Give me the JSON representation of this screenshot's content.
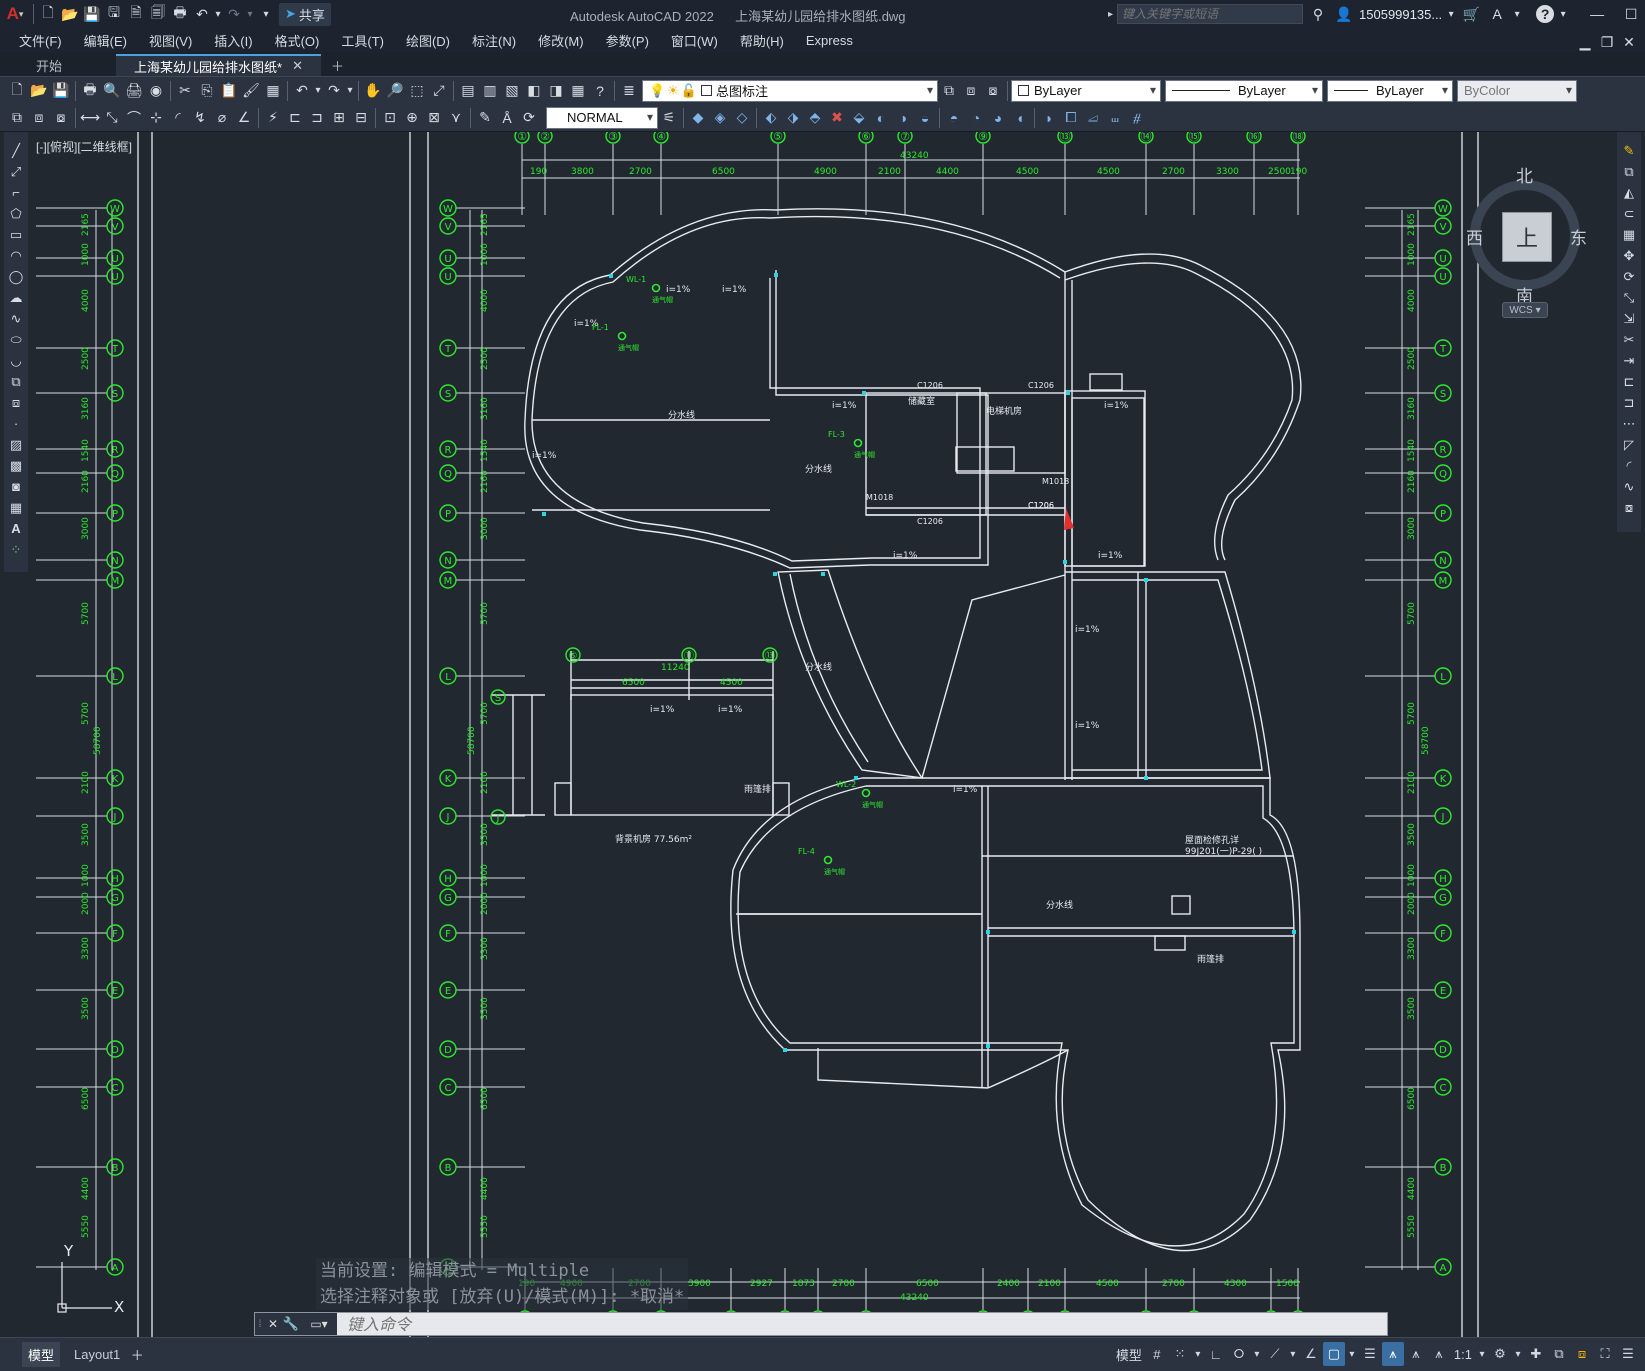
{
  "app": {
    "name": "Autodesk AutoCAD 2022",
    "file": "上海某幼儿园给排水图纸.dwg",
    "share_label": "共享",
    "search_placeholder": "键入关键字或短语",
    "user": "1505999135...",
    "accent_color": "#4aa3e0",
    "logo_color": "#d0312d"
  },
  "menubar": [
    "文件(F)",
    "编辑(E)",
    "视图(V)",
    "插入(I)",
    "格式(O)",
    "工具(T)",
    "绘图(D)",
    "标注(N)",
    "修改(M)",
    "参数(P)",
    "窗口(W)",
    "帮助(H)",
    "Express"
  ],
  "tabs": [
    {
      "label": "开始",
      "active": false
    },
    {
      "label": "上海某幼儿园给排水图纸*",
      "active": true
    }
  ],
  "toolbar": {
    "layer_name": "总图标注",
    "color": "ByLayer",
    "linetype": "ByLayer",
    "lineweight": "ByLayer",
    "plotstyle": "ByColor",
    "dimstyle": "NORMAL"
  },
  "viewport_label": "[-][俯视][二维线框]",
  "viewcube": {
    "north": "北",
    "south": "南",
    "east": "东",
    "west": "西",
    "top": "上",
    "wcs": "WCS"
  },
  "drawing": {
    "grid_cols_top": [
      "①",
      "②",
      "③",
      "④",
      "⑤",
      "⑥",
      "⑦",
      "⑧",
      "⑨",
      "⑩",
      "⑪",
      "⑫",
      "⑬",
      "⑭",
      "⑮",
      "⑯",
      "⑰",
      "⑱"
    ],
    "top_dims": [
      "190",
      "3800",
      "2700",
      "6500",
      "4900",
      "2100",
      "4400",
      "4500",
      "4500",
      "2700",
      "3300",
      "2500",
      "190"
    ],
    "top_total": "43240",
    "bottom_dims": [
      "190",
      "4900",
      "2700",
      "3900",
      "2927",
      "1873",
      "2700",
      "6500",
      "2400",
      "2100",
      "4500",
      "2700",
      "4300",
      "1500"
    ],
    "bottom_total": "43240",
    "row_axes": [
      "W",
      "V",
      "U",
      "T",
      "S",
      "R",
      "Q",
      "P",
      "N",
      "M",
      "L",
      "K",
      "J",
      "H",
      "G",
      "F",
      "E",
      "D",
      "C",
      "B",
      "A"
    ],
    "left_dims": [
      "2165",
      "1000",
      "4000",
      "2500",
      "3160",
      "1540",
      "2160",
      "3000",
      "5700",
      "5700",
      "2100",
      "3500",
      "1000",
      "2000",
      "3300",
      "3500",
      "6500",
      "4400",
      "5550"
    ],
    "left_total": "58700",
    "inner_cols": [
      "⑤",
      "⑪",
      "⑬"
    ],
    "inner_dims": [
      "6500",
      "4500"
    ],
    "inner_total": "11240",
    "room_labels": [
      "分水线",
      "分水线",
      "分水线",
      "分水线",
      "储藏室",
      "电梯机房",
      "雨篷排",
      "雨篷排",
      "屋面检修孔详",
      "99J201(一)P-29(   )",
      "背景机房 77.56m²"
    ],
    "slopes": [
      "i=1%",
      "i=1%",
      "i=1%",
      "i=1%",
      "i=1%",
      "i=1%",
      "i=1%",
      "i=1%",
      "i=1%",
      "i=1%",
      "i=1%",
      "i=1%",
      "i=1%"
    ],
    "pipe_tags": [
      "WL-1",
      "FL-1",
      "FL-3",
      "WL-2",
      "FL-4"
    ],
    "vent_labels": [
      "通气帽",
      "通气帽",
      "通气帽",
      "通气帽",
      "通气帽"
    ],
    "door_window_tags": [
      "C1206",
      "C1206",
      "C1206",
      "C1206",
      "M1018",
      "M1018",
      "C1206"
    ],
    "ucs": {
      "y": "Y",
      "x": "X"
    }
  },
  "command": {
    "history_1": "当前设置: 编辑模式 = Multiple",
    "history_2": "选择注释对象或 [放弃(U)/模式(M)]: *取消*",
    "placeholder": "键入命令"
  },
  "layout_tabs": [
    "模型",
    "Layout1"
  ],
  "status": {
    "model": "模型",
    "scale": "1:1"
  }
}
